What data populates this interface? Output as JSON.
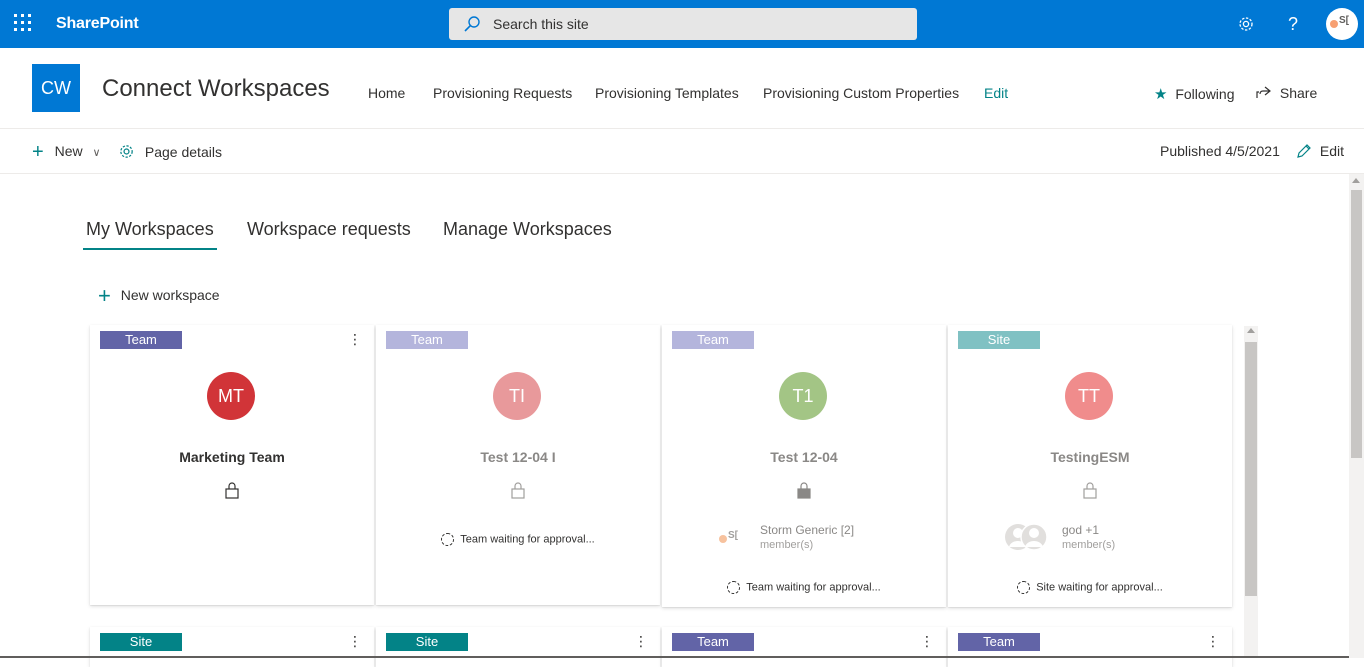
{
  "suite_bar": {
    "app_name": "SharePoint",
    "search_placeholder": "Search this site",
    "user_initials": "S["
  },
  "site_header": {
    "logo_text": "CW",
    "title": "Connect Workspaces",
    "nav": [
      "Home",
      "Provisioning Requests",
      "Provisioning Templates",
      "Provisioning Custom Properties",
      "Edit"
    ],
    "following_label": "Following",
    "share_label": "Share"
  },
  "command_bar": {
    "new_label": "New",
    "page_details_label": "Page details",
    "published_label": "Published 4/5/2021",
    "edit_label": "Edit"
  },
  "tabs": [
    "My Workspaces",
    "Workspace requests",
    "Manage Workspaces"
  ],
  "new_workspace_label": "New workspace",
  "colors": {
    "suite": "#0078d4",
    "accent": "#038387",
    "team_tag": "#6264a7",
    "team_tag_pending": "#b4b5dc",
    "site_tag": "#038387",
    "site_tag_pending": "#80c1c3"
  },
  "cards": [
    {
      "tag": "Team",
      "initials": "MT",
      "name": "Marketing Team",
      "persona_color": "#d13438",
      "status": ""
    },
    {
      "tag": "Team",
      "initials": "TI",
      "name": "Test 12-04 I",
      "persona_color": "#e8999b",
      "status": "Team waiting for approval..."
    },
    {
      "tag": "Team",
      "initials": "T1",
      "name": "Test 12-04",
      "persona_color": "#a3c585",
      "member_name": "Storm Generic [2]",
      "member_sub": "member(s)",
      "member_initials": "S[",
      "status": "Team waiting for approval..."
    },
    {
      "tag": "Site",
      "initials": "TT",
      "name": "TestingESM",
      "persona_color": "#f08c8c",
      "member_name": "god +1",
      "member_sub": "member(s)",
      "status": "Site waiting for approval..."
    }
  ],
  "row2_tags": [
    "Site",
    "Site",
    "Team",
    "Team"
  ]
}
